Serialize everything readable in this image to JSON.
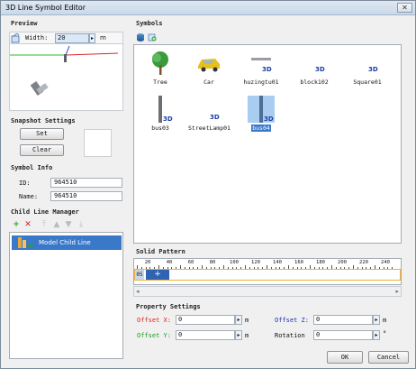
{
  "window": {
    "title": "3D Line Symbol Editor",
    "close_glyph": "✕"
  },
  "preview": {
    "group_title": "Preview",
    "width_label": "Width:",
    "width_value": "20",
    "unit": "m",
    "spin_glyph": "▸"
  },
  "snapshot": {
    "group_title": "Snapshot Settings",
    "set_label": "Set",
    "clear_label": "Clear"
  },
  "symbol_info": {
    "group_title": "Symbol Info",
    "id_label": "ID:",
    "id_value": "964510",
    "name_label": "Name:",
    "name_value": "964510"
  },
  "child_line": {
    "group_title": "Child Line Manager",
    "items": [
      {
        "label": "Model Child Line",
        "selected": true
      }
    ]
  },
  "symbols": {
    "group_title": "Symbols",
    "tag": "3D",
    "items": [
      {
        "label": "Tree",
        "icon": "tree-icon"
      },
      {
        "label": "Car",
        "icon": "car-icon"
      },
      {
        "label": "huzingtu01",
        "icon": "model-icon"
      },
      {
        "label": "block102",
        "icon": "model-icon"
      },
      {
        "label": "Square01",
        "icon": "model-icon"
      },
      {
        "label": "bus03",
        "icon": "pole-icon"
      },
      {
        "label": "StreetLamp01",
        "icon": "model-icon"
      },
      {
        "label": "bus04",
        "icon": "pole-icon",
        "selected": true
      }
    ]
  },
  "solid_pattern": {
    "group_title": "Solid Pattern",
    "ticks": [
      "20",
      "40",
      "60",
      "80",
      "100",
      "120",
      "140",
      "160",
      "180",
      "200",
      "220",
      "240"
    ],
    "segment_label": "05",
    "add_glyph": "+"
  },
  "property": {
    "group_title": "Property Settings",
    "offset_x_label": "Offset X:",
    "offset_x_value": "0",
    "offset_y_label": "Offset Y:",
    "offset_y_value": "0",
    "offset_z_label": "Offset Z:",
    "offset_z_value": "0",
    "rotation_label": "Rotation",
    "rotation_value": "0",
    "unit_m": "m",
    "unit_deg": "°",
    "label_color_x": "#e0201b",
    "label_color_y": "#1a9c1a",
    "label_color_z": "#1b2fb0",
    "spin_glyph": "▸"
  },
  "footer": {
    "ok_label": "OK",
    "cancel_label": "Cancel"
  },
  "accent_color": "#3a78c9"
}
